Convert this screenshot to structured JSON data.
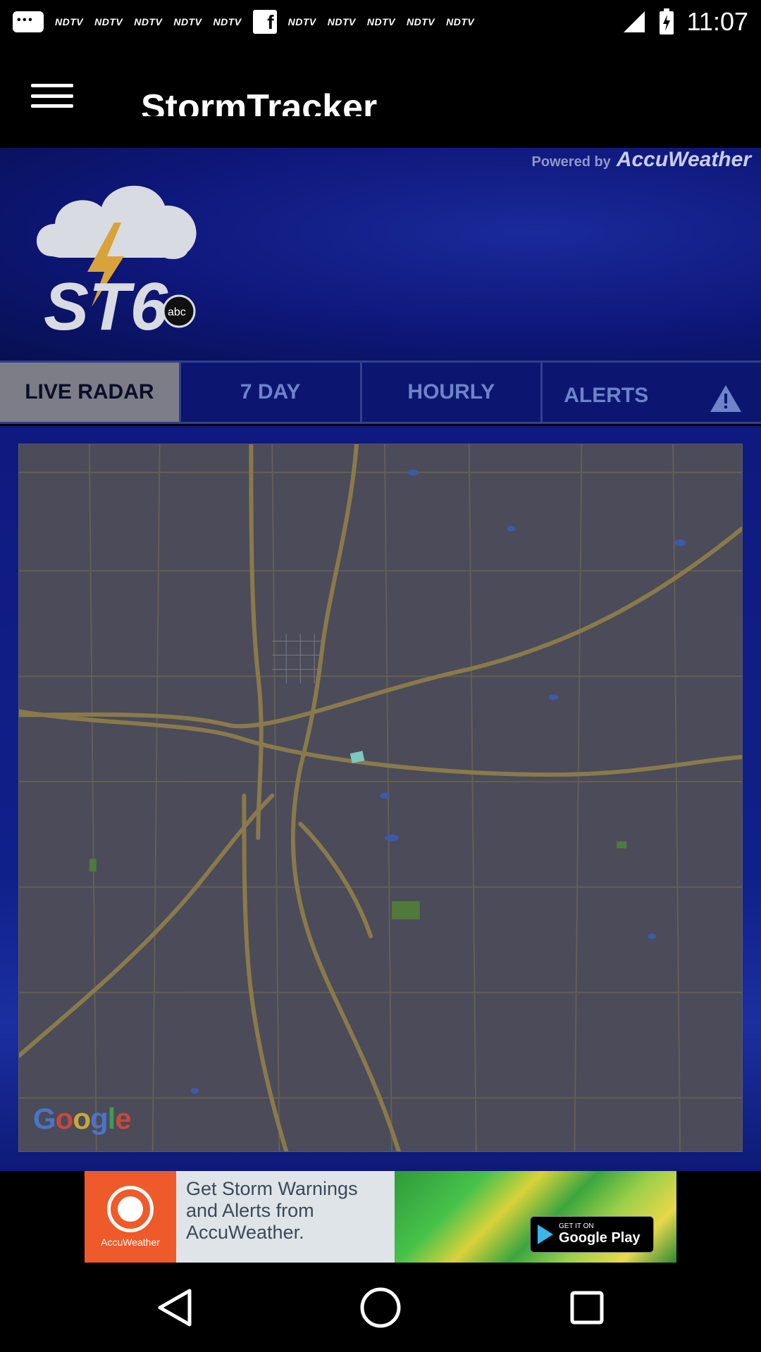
{
  "status_bar": {
    "notifications": [
      "NDTV",
      "NDTV",
      "NDTV",
      "NDTV",
      "NDTV"
    ],
    "notifications_after_fb": [
      "NDTV",
      "NDTV",
      "NDTV",
      "NDTV",
      "NDTV"
    ],
    "time": "11:07"
  },
  "app_bar": {
    "title": "StormTracker"
  },
  "banner": {
    "powered_by": "Powered by",
    "brand": "AccuWeather",
    "logo_text": "ST6"
  },
  "tabs": [
    {
      "label": "LIVE RADAR",
      "active": true
    },
    {
      "label": "7 DAY",
      "active": false
    },
    {
      "label": "HOURLY",
      "active": false
    },
    {
      "label": "ALERTS",
      "active": false
    }
  ],
  "map": {
    "attribution": [
      "G",
      "o",
      "o",
      "g",
      "l",
      "e"
    ]
  },
  "ad": {
    "logo_label": "AccuWeather",
    "text": "Get Storm Warnings and Alerts from AccuWeather.",
    "store_small": "GET IT ON",
    "store_big": "Google Play"
  },
  "colors": {
    "banner_blue": "#0e177a",
    "tab_text": "#6e83c9",
    "active_tab": "#7c7d86",
    "map_bg": "#4b4b5a",
    "road": "#8a7a4a"
  }
}
